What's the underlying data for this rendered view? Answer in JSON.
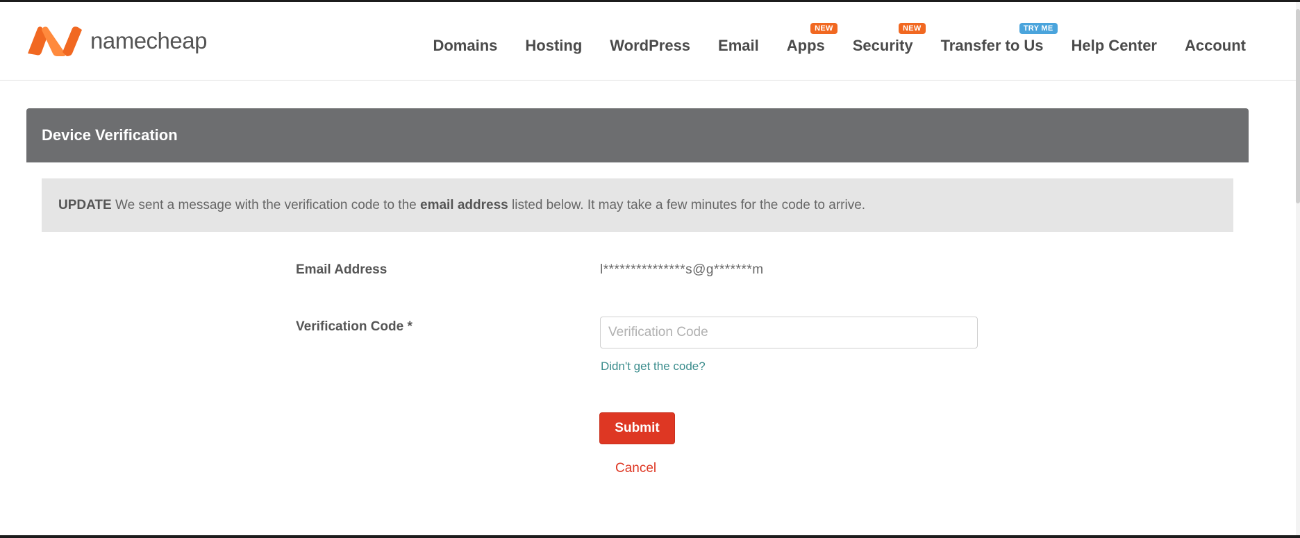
{
  "logo": {
    "text": "namecheap",
    "icon": "namecheap-logo-icon"
  },
  "nav": [
    {
      "label": "Domains",
      "badge": ""
    },
    {
      "label": "Hosting",
      "badge": ""
    },
    {
      "label": "WordPress",
      "badge": ""
    },
    {
      "label": "Email",
      "badge": ""
    },
    {
      "label": "Apps",
      "badge": "NEW"
    },
    {
      "label": "Security",
      "badge": "NEW"
    },
    {
      "label": "Transfer to Us",
      "badge": "TRY ME"
    },
    {
      "label": "Help Center",
      "badge": ""
    },
    {
      "label": "Account",
      "badge": ""
    }
  ],
  "panel": {
    "title": "Device Verification"
  },
  "notice": {
    "prefix": "UPDATE",
    "text_before": " We sent a message with the verification code to the ",
    "emphasis": "email address",
    "text_after": " listed below. It may take a few minutes for the code to arrive."
  },
  "form": {
    "email_label": "Email Address",
    "email_value": "l***************s@g*******m",
    "code_label": "Verification Code *",
    "code_placeholder": "Verification Code",
    "code_value": "",
    "help_link": "Didn't get the code?",
    "submit_label": "Submit",
    "cancel_label": "Cancel"
  },
  "colors": {
    "brand_orange": "#f16821",
    "panel_gray": "#6d6e70",
    "submit_red": "#de3723",
    "link_teal": "#3a8c8c",
    "badge_blue": "#4aa4dc"
  }
}
